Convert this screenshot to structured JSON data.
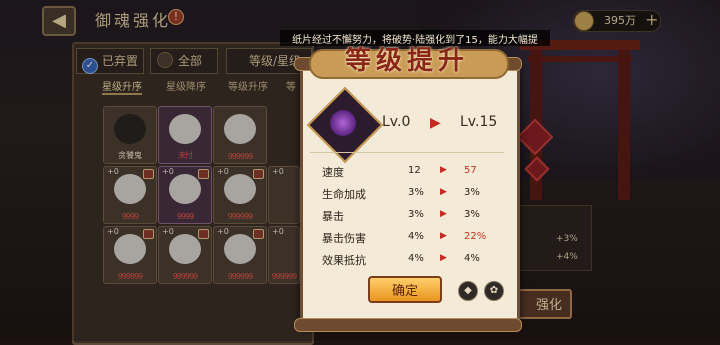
{
  "header": {
    "back_icon": "back-arrow-icon",
    "title": "御魂强化",
    "warn": "!",
    "currency": "395万",
    "plus": "+"
  },
  "filters": {
    "abandoned": "已弃置",
    "all": "全部",
    "sort_prefix": "等级/星级"
  },
  "sort_tabs": [
    "星级升序",
    "星级降序",
    "等级升序",
    "等"
  ],
  "cards": [
    {
      "type": "dark",
      "name": "贪饕鬼",
      "lvl": ""
    },
    {
      "type": "purple",
      "name": "",
      "lvl": "",
      "stars": "未付"
    },
    {
      "type": "",
      "name": "",
      "lvl": "",
      "stars": "999999"
    },
    {
      "type": "",
      "name": "",
      "lvl": "+0",
      "stars": "9999"
    },
    {
      "type": "purple",
      "name": "",
      "lvl": "+0",
      "stars": "9999"
    },
    {
      "type": "",
      "name": "",
      "lvl": "+0",
      "stars": "999999"
    },
    {
      "type": "",
      "name": "",
      "lvl": "+0",
      "stars": "9999"
    },
    {
      "type": "",
      "name": "",
      "lvl": "+0",
      "stars": "999999"
    },
    {
      "type": "",
      "name": "",
      "lvl": "+0",
      "stars": "999999"
    },
    {
      "type": "",
      "name": "",
      "lvl": "+0",
      "stars": "999999"
    },
    {
      "type": "",
      "name": "",
      "lvl": "+0",
      "stars": "999999"
    },
    {
      "type": "",
      "name": "",
      "lvl": "+0",
      "stars": "999999"
    }
  ],
  "side_stats": {
    "a": "+3%",
    "b": "+4%"
  },
  "enhance_button": "强化",
  "banner": "纸片经过不懈努力，将破势·陆强化到了15，能力大幅提",
  "modal": {
    "title": "等级提升",
    "from": "Lv.0",
    "to": "Lv.15",
    "rows": [
      {
        "label": "速度",
        "from": "12",
        "to": "57",
        "up": true
      },
      {
        "label": "生命加成",
        "from": "3%",
        "to": "3%",
        "up": false
      },
      {
        "label": "暴击",
        "from": "3%",
        "to": "3%",
        "up": false
      },
      {
        "label": "暴击伤害",
        "from": "4%",
        "to": "22%",
        "up": true
      },
      {
        "label": "效果抵抗",
        "from": "4%",
        "to": "4%",
        "up": false
      }
    ],
    "confirm": "确定"
  },
  "colors": {
    "accent_red": "#c42a22",
    "button_orange": "#e9941f",
    "scroll_paper": "#f3ead7"
  }
}
